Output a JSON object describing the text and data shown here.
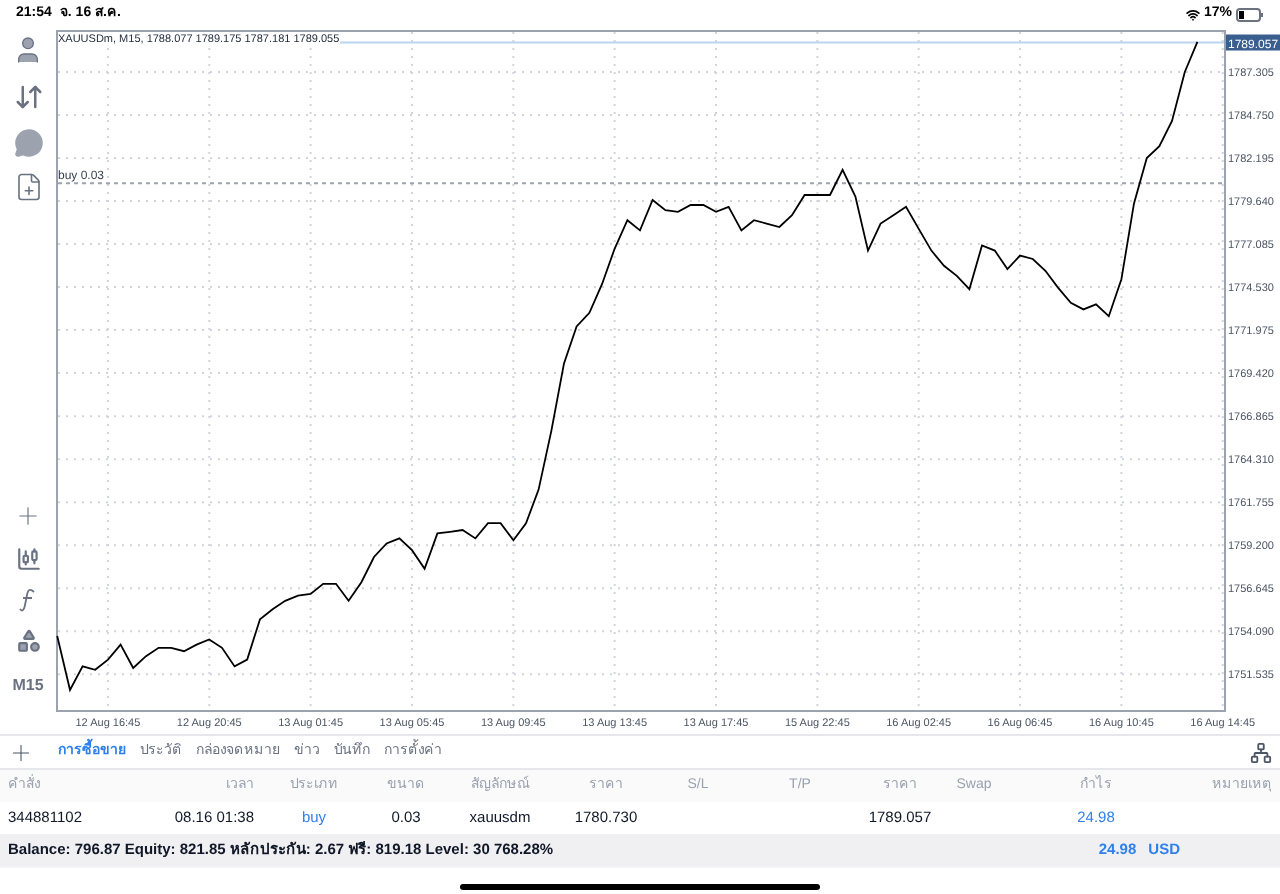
{
  "status_bar": {
    "time": "21:54",
    "date": "จ. 16 ส.ค.",
    "battery": "17%"
  },
  "toolbar": {
    "timeframe": "M15"
  },
  "chart": {
    "header": "XAUUSDm, M15, 1788.077 1789.175 1787.181 1789.055",
    "chart_data": {
      "type": "line",
      "grid": true,
      "ylim": [
        1749.41,
        1789.8
      ],
      "ref_lines": [
        {
          "axis": "y",
          "value": 1780.7,
          "label": "buy 0.03",
          "color": "#9ca3af"
        },
        {
          "axis": "y",
          "value": 1789.057,
          "label": "1789.057",
          "color": "#bcd3ee"
        }
      ],
      "categories": [
        null,
        null,
        null,
        null,
        "12 Aug 16:45",
        null,
        null,
        null,
        null,
        null,
        null,
        null,
        "12 Aug 20:45",
        null,
        null,
        null,
        null,
        null,
        null,
        null,
        "13 Aug 01:45",
        null,
        null,
        null,
        null,
        null,
        null,
        null,
        "13 Aug 05:45",
        null,
        null,
        null,
        null,
        null,
        null,
        null,
        "13 Aug 09:45",
        null,
        null,
        null,
        null,
        null,
        null,
        null,
        "13 Aug 13:45",
        null,
        null,
        null,
        null,
        null,
        null,
        null,
        "13 Aug 17:45",
        null,
        null,
        null,
        null,
        null,
        null,
        null,
        "15 Aug 22:45",
        null,
        null,
        null,
        null,
        null,
        null,
        null,
        "16 Aug 02:45",
        null,
        null,
        null,
        null,
        null,
        null,
        null,
        "16 Aug 06:45",
        null,
        null,
        null,
        null,
        null,
        null,
        null,
        "16 Aug 10:45",
        null,
        null,
        null,
        null,
        null,
        null,
        null,
        "16 Aug 14:45"
      ],
      "series": [
        {
          "color": "#000000",
          "values": [
            1753.8,
            1750.6,
            1752.0,
            1751.8,
            1752.4,
            1753.3,
            1751.9,
            1752.6,
            1753.1,
            1753.1,
            1752.9,
            1753.3,
            1753.6,
            1753.1,
            1752.0,
            1752.4,
            1754.8,
            1755.4,
            1755.9,
            1756.2,
            1756.3,
            1756.9,
            1756.9,
            1755.9,
            1757.0,
            1758.5,
            1759.3,
            1759.6,
            1758.9,
            1757.8,
            1759.9,
            1760.0,
            1760.1,
            1759.6,
            1760.5,
            1760.5,
            1759.5,
            1760.5,
            1762.5,
            1766.0,
            1770.0,
            1772.2,
            1773.0,
            1774.7,
            1776.8,
            1778.5,
            1777.9,
            1779.7,
            1779.1,
            1779.0,
            1779.4,
            1779.4,
            1779.0,
            1779.3,
            1777.9,
            1778.5,
            1778.3,
            1778.1,
            1778.8,
            1780.0,
            1780.0,
            1780.0,
            1781.5,
            1779.9,
            1776.7,
            1778.3,
            1778.8,
            1779.3,
            1778.0,
            1776.7,
            1775.8,
            1775.2,
            1774.4,
            1777.0,
            1776.7,
            1775.6,
            1776.4,
            1776.2,
            1775.5,
            1774.5,
            1773.6,
            1773.2,
            1773.5,
            1772.8,
            1775.0,
            1779.5,
            1782.2,
            1782.9,
            1784.4,
            1787.3,
            1789.1,
            null,
            null
          ]
        }
      ],
      "yticks": [
        {
          "value": 1787.305,
          "label": "1787.305"
        },
        {
          "value": 1784.75,
          "label": "1784.750"
        },
        {
          "value": 1782.195,
          "label": "1782.195"
        },
        {
          "value": 1779.64,
          "label": "1779.640"
        },
        {
          "value": 1777.085,
          "label": "1777.085"
        },
        {
          "value": 1774.53,
          "label": "1774.530"
        },
        {
          "value": 1771.975,
          "label": "1771.975"
        },
        {
          "value": 1769.42,
          "label": "1769.420"
        },
        {
          "value": 1766.865,
          "label": "1766.865"
        },
        {
          "value": 1764.31,
          "label": "1764.310"
        },
        {
          "value": 1761.755,
          "label": "1761.755"
        },
        {
          "value": 1759.2,
          "label": "1759.200"
        },
        {
          "value": 1756.645,
          "label": "1756.645"
        },
        {
          "value": 1754.09,
          "label": "1754.090"
        },
        {
          "value": 1751.535,
          "label": "1751.535"
        }
      ]
    }
  },
  "tabs": [
    {
      "label": "การซื้อขาย",
      "selected": true
    },
    {
      "label": "ประวัติ",
      "selected": false
    },
    {
      "label": "กล่องจดหมาย",
      "selected": false
    },
    {
      "label": "ข่าว",
      "selected": false
    },
    {
      "label": "บันทึก",
      "selected": false
    },
    {
      "label": "การตั้งค่า",
      "selected": false
    }
  ],
  "table": {
    "columns": [
      "คำสั่ง",
      "เวลา",
      "ประเภท",
      "ขนาด",
      "สัญลักษณ์",
      "ราคา",
      "S/L",
      "T/P",
      "ราคา",
      "Swap",
      "กำไร",
      "หมายเหตุ"
    ],
    "rows": [
      {
        "cells": [
          "344881102",
          "08.16 01:38",
          "buy",
          "0.03",
          "xauusdm",
          "1780.730",
          null,
          null,
          "1789.057",
          null,
          "24.98",
          null
        ]
      }
    ]
  },
  "summary": {
    "text": "Balance: 796.87 Equity: 821.85 หลักประกัน: 2.67 ฟรี: 819.18 Level: 30 768.28%",
    "profit": "24.98",
    "currency": "USD"
  }
}
